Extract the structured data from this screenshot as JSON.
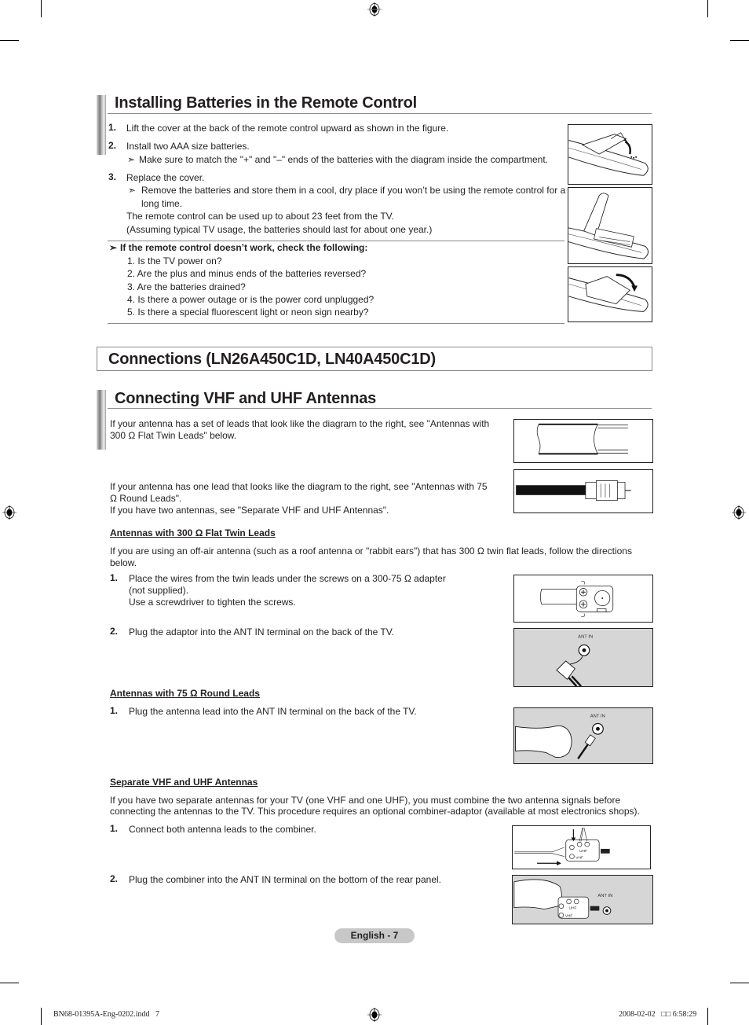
{
  "section_batteries": {
    "title": "Installing Batteries in the Remote Control",
    "steps": [
      {
        "num": "1.",
        "text": "Lift the cover at the back of the remote control upward as shown in the figure."
      },
      {
        "num": "2.",
        "text": "Install two AAA size batteries.",
        "note": "Make sure to match the \"+\" and \"–\" ends of the batteries with the diagram inside the compartment."
      },
      {
        "num": "3.",
        "text": "Replace the cover.",
        "note_line1": "Remove the batteries and store them in a cool, dry place if you won’t be using the remote control for a",
        "note_line2": "long time.",
        "extra1": "The remote control can be used up to about 23 feet from the TV.",
        "extra2": "(Assuming typical TV usage, the batteries should last for about one year.)"
      }
    ],
    "check": {
      "heading": "If the remote control doesn’t work, check the following:",
      "items": [
        "1. Is the TV power on?",
        "2. Are the plus and minus ends of the batteries reversed?",
        "3. Are the batteries drained?",
        "4. Is there a power outage or is the power cord unplugged?",
        "5. Is there a special fluorescent light or neon sign nearby?"
      ]
    },
    "arrow_glyph": "➣"
  },
  "connections": {
    "title": "Connections (LN26A450C1D, LN40A450C1D)"
  },
  "section_antennas": {
    "title": "Connecting VHF and UHF Antennas",
    "intro1_l1": "If your antenna has a set of leads that look like the diagram to the right, see \"Antennas with",
    "intro1_l2": "300 Ω Flat Twin Leads\" below.",
    "intro2_l1": "If your antenna has one lead that looks like the diagram to the right, see \"Antennas with 75",
    "intro2_l2": "Ω Round Leads\".",
    "intro2_l3": "If you have two antennas, see \"Separate VHF and UHF Antennas\".",
    "flat": {
      "heading": "Antennas with 300 Ω Flat Twin Leads",
      "desc_l1": "If you are using an off-air antenna (such as a roof antenna or \"rabbit ears\") that has 300 Ω twin flat leads, follow the directions",
      "desc_l2": "below.",
      "step1_num": "1.",
      "step1_l1": "Place the wires from the twin leads under the screws on a 300-75 Ω adapter",
      "step1_l2": "(not supplied).",
      "step1_l3": "Use a screwdriver to tighten the screws.",
      "step2_num": "2.",
      "step2": "Plug the adaptor into the ANT IN terminal on the back of the TV."
    },
    "round": {
      "heading": "Antennas with 75 Ω Round Leads",
      "step1_num": "1.",
      "step1": "Plug the antenna lead into the ANT IN terminal on the back of the TV."
    },
    "separate": {
      "heading": "Separate VHF and UHF Antennas",
      "desc_l1": "If you have two separate antennas for your TV (one VHF and one UHF), you must combine the two antenna signals before",
      "desc_l2": "connecting the antennas to the TV. This procedure requires an optional combiner-adaptor (available at most electronics shops).",
      "step1_num": "1.",
      "step1": "Connect both antenna leads to the combiner.",
      "step2_num": "2.",
      "step2": "Plug the combiner into the ANT IN terminal on the bottom of the rear panel."
    },
    "fig_labels": {
      "ant_in": "ANT IN",
      "uhf": "UHF",
      "vhf": "VHF"
    }
  },
  "footer": {
    "page_label": "English - 7",
    "slug_file": "BN68-01395A-Eng-0202.indd   7",
    "slug_date": "2008-02-02   □□ 6:58:29"
  }
}
